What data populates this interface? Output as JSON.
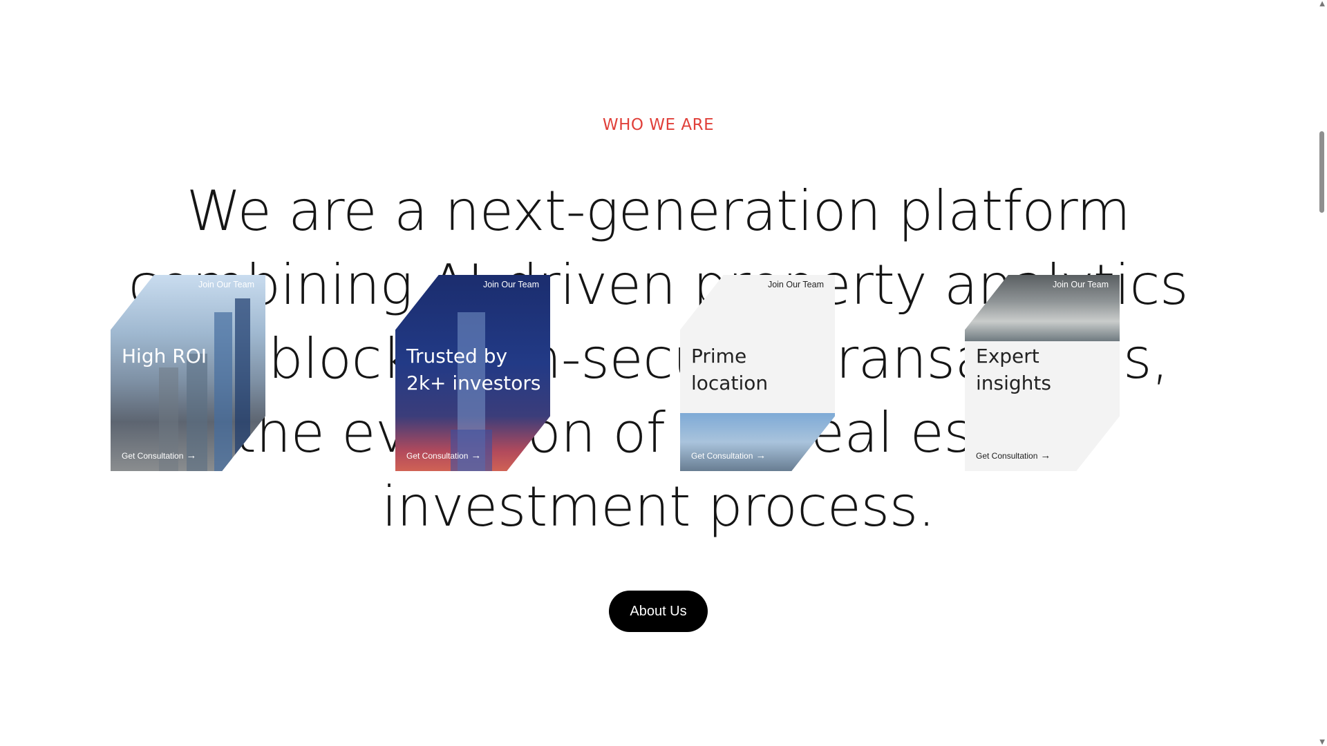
{
  "section": {
    "eyebrow": "WHO WE ARE",
    "headline": "We are a next-generation platform combining AI-driven property analytics and blockchain-secured transactions, the evolution of the real estate investment process.",
    "accent_color": "#e0403a"
  },
  "cta": {
    "label": "About Us"
  },
  "cards": [
    {
      "top": "Join Our Team",
      "title": "High ROI",
      "consultation": "Get Consultation"
    },
    {
      "top": "Join Our Team",
      "title": "Trusted by 2k+ investors",
      "consultation": "Get Consultation"
    },
    {
      "top": "Join Our Team",
      "title": "Prime location",
      "consultation": "Get Consultation"
    },
    {
      "top": "Join Our Team",
      "title": "Expert insights",
      "consultation": "Get Consultation"
    }
  ],
  "icons": {
    "arrow": "arrow-right-icon"
  }
}
